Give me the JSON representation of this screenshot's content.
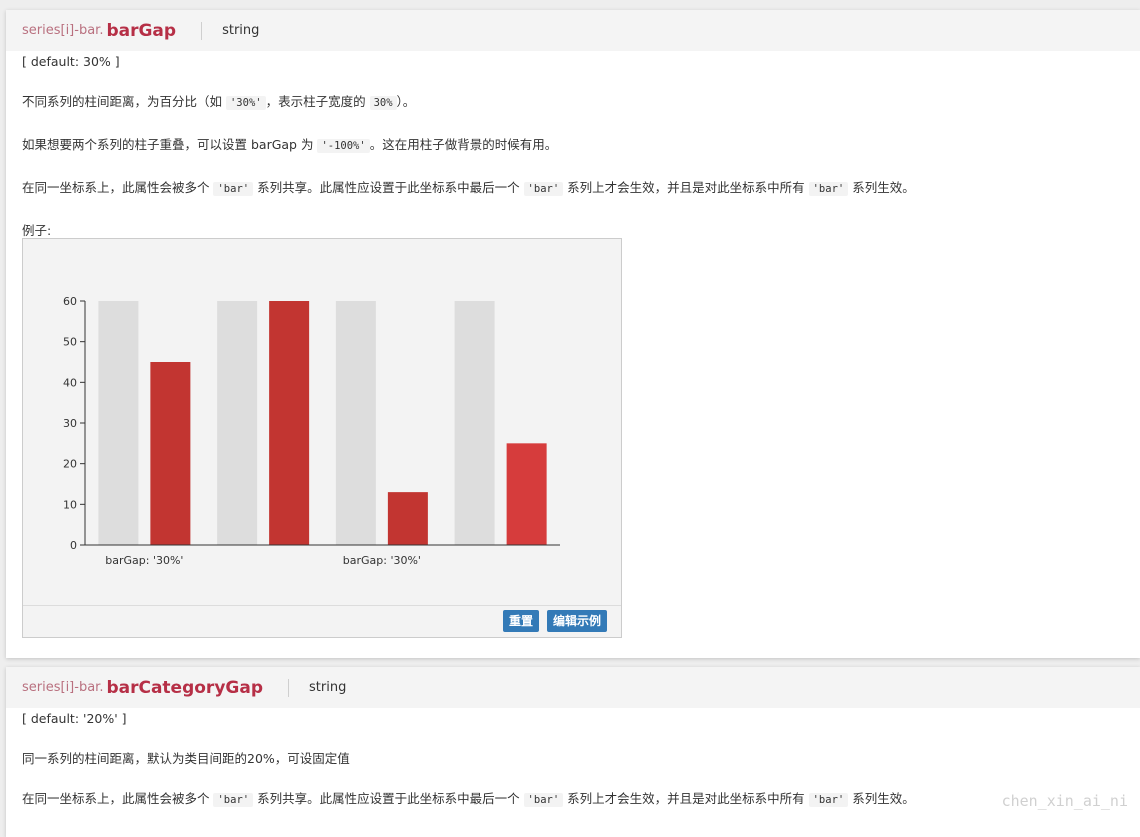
{
  "card1": {
    "prefix": "series[i]-bar.",
    "name": "barGap",
    "type": "string",
    "default_text": "[ default: 30% ]",
    "p1": {
      "a": "不同系列的柱间距离，为百分比（如 ",
      "c1": "'30%'",
      "b": "，表示柱子宽度的 ",
      "c2": "30%",
      "d": "）。"
    },
    "p2": {
      "a": "如果想要两个系列的柱子重叠，可以设置 barGap 为 ",
      "c1": "'-100%'",
      "b": "。这在用柱子做背景的时候有用。"
    },
    "p3": {
      "a": "在同一坐标系上，此属性会被多个 ",
      "c1": "'bar'",
      "b": " 系列共享。此属性应设置于此坐标系中最后一个 ",
      "c2": "'bar'",
      "d": " 系列上才会生效，并且是对此坐标系中所有 ",
      "c3": "'bar'",
      "e": " 系列生效。"
    },
    "example_label": "例子:",
    "reset_label": "重置",
    "edit_label": "编辑示例"
  },
  "card2": {
    "prefix": "series[i]-bar.",
    "name": "barCategoryGap",
    "type": "string",
    "default_text": "[ default: '20%' ]",
    "p1": "同一系列的柱间距离，默认为类目间距的20%，可设固定值",
    "p2": {
      "a": "在同一坐标系上，此属性会被多个 ",
      "c1": "'bar'",
      "b": " 系列共享。此属性应设置于此坐标系中最后一个 ",
      "c2": "'bar'",
      "d": " 系列上才会生效，并且是对此坐标系中所有 ",
      "c3": "'bar'",
      "e": " 系列生效。"
    },
    "watermark": "chen_xin_ai_ni"
  },
  "chart_data": {
    "type": "bar",
    "ylim": [
      0,
      60
    ],
    "yticks": [
      0,
      10,
      20,
      30,
      40,
      50,
      60
    ],
    "groups": [
      {
        "label": "barGap: '30%'",
        "bars": [
          {
            "value": 60,
            "color": "#dddddd"
          },
          {
            "value": 45,
            "color": "#c23531"
          }
        ]
      },
      {
        "label": "",
        "bars": [
          {
            "value": 60,
            "color": "#dddddd"
          },
          {
            "value": 60,
            "color": "#c23531"
          }
        ]
      },
      {
        "label": "barGap: '30%'",
        "bars": [
          {
            "value": 60,
            "color": "#dddddd"
          },
          {
            "value": 13,
            "color": "#c23531"
          }
        ]
      },
      {
        "label": "",
        "bars": [
          {
            "value": 60,
            "color": "#dddddd"
          },
          {
            "value": 25,
            "color": "#d63c3c"
          }
        ]
      }
    ]
  }
}
